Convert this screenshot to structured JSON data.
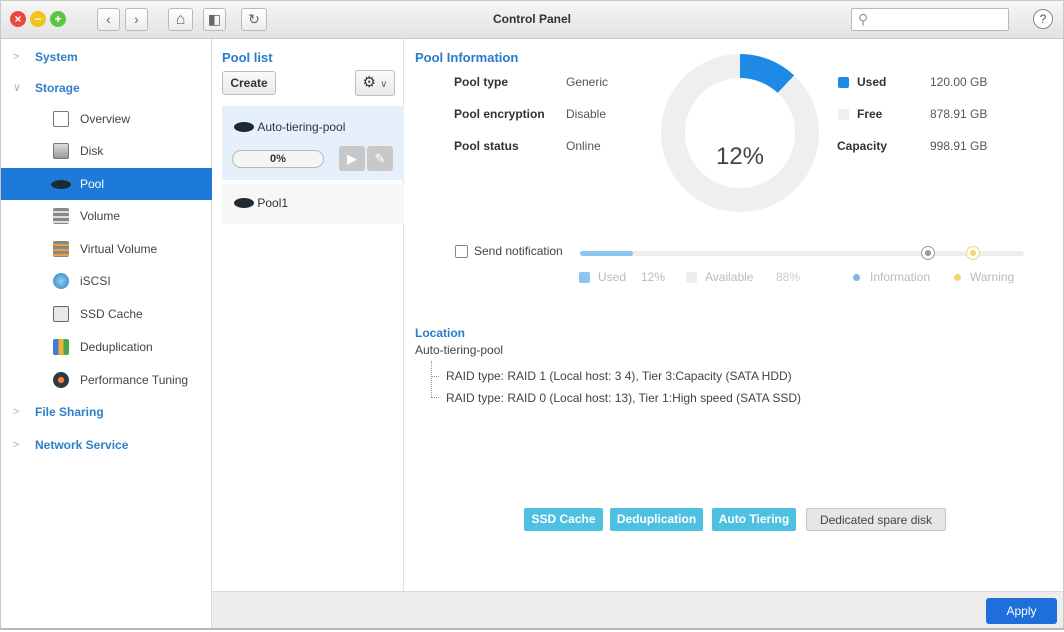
{
  "window": {
    "title": "Control Panel",
    "search_placeholder": "",
    "help_glyph": "?"
  },
  "toolbar": {
    "close_glyph": "×",
    "minimize_glyph": "−",
    "maximize_glyph": "+",
    "back_glyph": "‹",
    "forward_glyph": "›",
    "home_glyph": "⌂",
    "sidebar_glyph": "◧",
    "refresh_glyph": "↻",
    "search_glyph": "⚲"
  },
  "sidebar": {
    "sections": {
      "system": "System",
      "storage": "Storage",
      "file_sharing": "File Sharing",
      "network_service": "Network Service"
    },
    "items": [
      "Overview",
      "Disk",
      "Pool",
      "Volume",
      "Virtual Volume",
      "iSCSI",
      "SSD Cache",
      "Deduplication",
      "Performance Tuning"
    ],
    "chevron_right": ">",
    "chevron_down": "∨"
  },
  "pool_list": {
    "heading": "Pool list",
    "create": "Create",
    "gear_glyph": "⚙",
    "caret": "∨",
    "pools": [
      {
        "name": "Auto-tiering-pool",
        "progress": "0%"
      },
      {
        "name": "Pool1"
      }
    ],
    "play_glyph": "▶",
    "edit_glyph": "✎"
  },
  "pool_info": {
    "heading": "Pool Information",
    "type_label": "Pool type",
    "type_value": "Generic",
    "encryption_label": "Pool encryption",
    "encryption_value": "Disable",
    "status_label": "Pool status",
    "status_value": "Online",
    "percent": "12%",
    "used_fraction": 0.12,
    "used_label": "Used",
    "used_value": "120.00 GB",
    "free_label": "Free",
    "free_value": "878.91 GB",
    "capacity_label": "Capacity",
    "capacity_value": "998.91 GB",
    "colors": {
      "used": "#1f8ae6",
      "free": "#efefef"
    }
  },
  "notification": {
    "label": "Send notification",
    "legend_used": "Used",
    "legend_used_pct": "12%",
    "legend_available": "Available",
    "legend_available_pct": "88%",
    "legend_information": "Information",
    "legend_warning": "Warning"
  },
  "location": {
    "heading": "Location",
    "pool": "Auto-tiering-pool",
    "raid1": "RAID type: RAID 1 (Local host: 3 4), Tier 3:Capacity (SATA HDD)",
    "raid0": "RAID type: RAID 0 (Local host: 13), Tier 1:High speed (SATA SSD)"
  },
  "tags": {
    "ssd_cache": "SSD Cache",
    "dedup": "Deduplication",
    "auto_tiering": "Auto Tiering",
    "spare": "Dedicated spare disk"
  },
  "footer": {
    "apply": "Apply"
  }
}
